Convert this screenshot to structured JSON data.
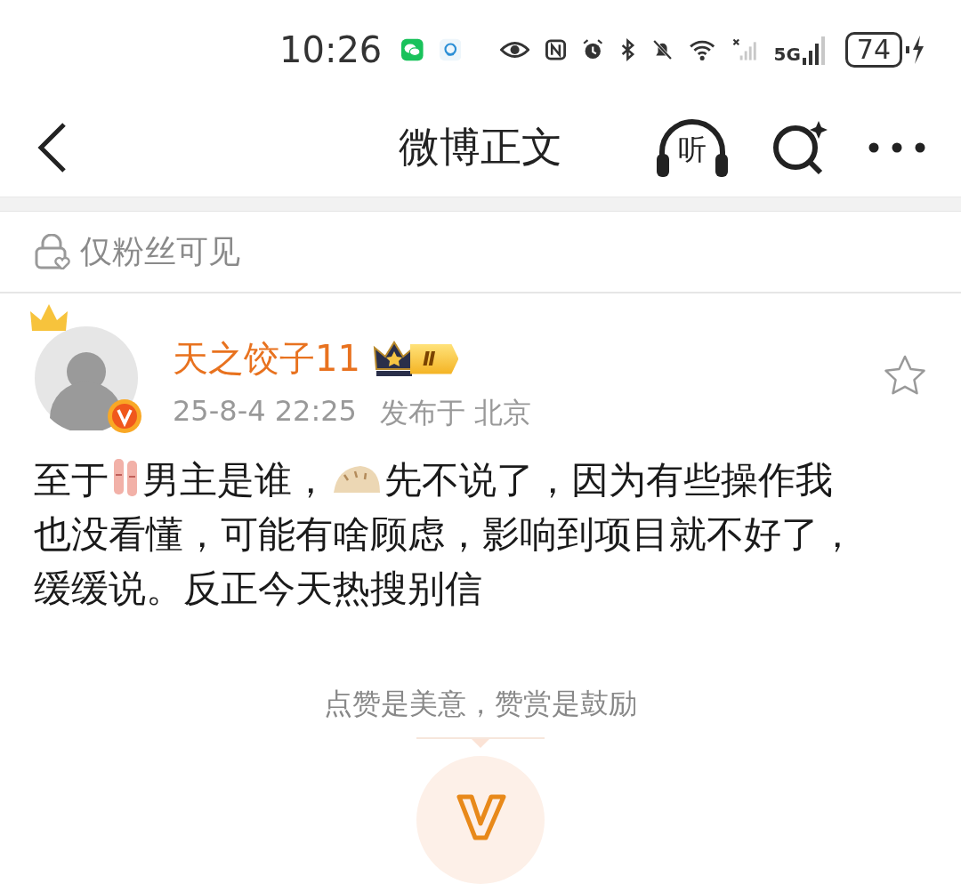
{
  "status_bar": {
    "time": "10:26",
    "network": "5G",
    "battery": "74",
    "charging": true
  },
  "nav": {
    "title": "微博正文",
    "listen_label": "听"
  },
  "visibility": {
    "label": "仅粉丝可见"
  },
  "post": {
    "author": "天之饺子11",
    "level": "Ⅱ",
    "verified": true,
    "favorited": false,
    "time": "25-8-4 22:25",
    "location": "发布于 北京",
    "body_lines": [
      [
        {
          "kind": "text",
          "text": "至于"
        },
        {
          "kind": "shoes"
        },
        {
          "kind": "text",
          "text": "男主是谁，"
        },
        {
          "kind": "dumpling"
        },
        {
          "kind": "text",
          "text": "先不说了，因为有些操作我"
        }
      ],
      [
        {
          "kind": "text",
          "text": "也没看懂，可能有啥顾虑，影响到项目就不好了，"
        }
      ],
      [
        {
          "kind": "text",
          "text": "缓缓说。反正今天热搜别信"
        }
      ]
    ]
  },
  "reward": {
    "hint": "点赞是美意，赞赏是鼓励"
  }
}
